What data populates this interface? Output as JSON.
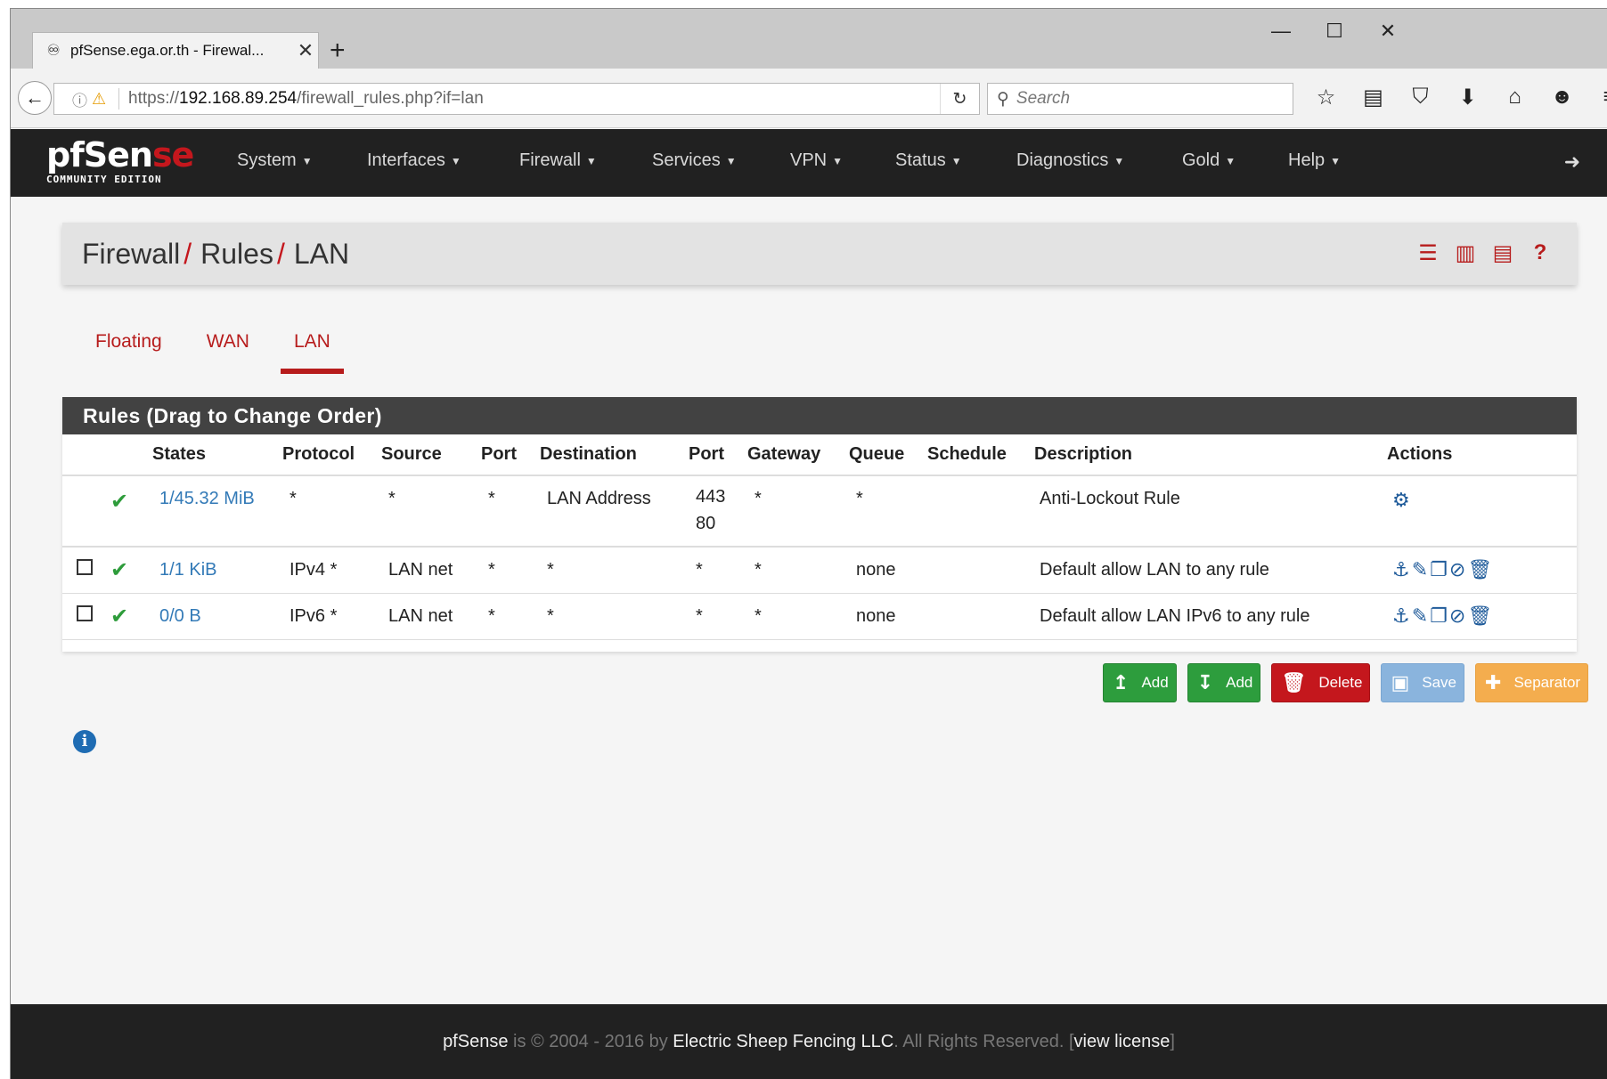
{
  "browser": {
    "tab_title": "pfSense.ega.or.th - Firewal...",
    "tab_close": "✕",
    "new_tab": "+",
    "url_scheme": "https://",
    "url_host": "192.168.89.254",
    "url_path": "/firewall_rules.php?if=lan",
    "search_placeholder": "Search",
    "window_controls": [
      "—",
      "☐",
      "✕"
    ]
  },
  "app": {
    "logo_main_a": "pfSen",
    "logo_main_b": "se",
    "logo_sub": "COMMUNITY EDITION",
    "menu": [
      "System",
      "Interfaces",
      "Firewall",
      "Services",
      "VPN",
      "Status",
      "Diagnostics",
      "Gold",
      "Help"
    ]
  },
  "page": {
    "breadcrumb": [
      "Firewall",
      "Rules",
      "LAN"
    ],
    "breadcrumb_sep": "/",
    "tabs": [
      "Floating",
      "WAN",
      "LAN"
    ],
    "active_tab": "LAN"
  },
  "rules": {
    "panel_title": "Rules (Drag to Change Order)",
    "columns": [
      "States",
      "Protocol",
      "Source",
      "Port",
      "Destination",
      "Port",
      "Gateway",
      "Queue",
      "Schedule",
      "Description",
      "Actions"
    ],
    "rows": [
      {
        "states": "1/45.32 MiB",
        "protocol": "*",
        "source": "*",
        "src_port": "*",
        "destination": "LAN Address",
        "dst_port_1": "443",
        "dst_port_2": "80",
        "gateway": "*",
        "queue": "*",
        "schedule": "",
        "description": "Anti-Lockout Rule"
      },
      {
        "states": "1/1 KiB",
        "protocol": "IPv4 *",
        "source": "LAN net",
        "src_port": "*",
        "destination": "*",
        "dst_port_1": "*",
        "dst_port_2": "",
        "gateway": "*",
        "queue": "none",
        "schedule": "",
        "description": "Default allow LAN to any rule"
      },
      {
        "states": "0/0 B",
        "protocol": "IPv6 *",
        "source": "LAN net",
        "src_port": "*",
        "destination": "*",
        "dst_port_1": "*",
        "dst_port_2": "",
        "gateway": "*",
        "queue": "none",
        "schedule": "",
        "description": "Default allow LAN IPv6 to any rule"
      }
    ]
  },
  "buttons": {
    "add_top": "Add",
    "add_bottom": "Add",
    "delete": "Delete",
    "save": "Save",
    "separator": "Separator"
  },
  "footer": {
    "brand": "pfSense",
    "text1": " is © 2004 - 2016 by ",
    "company": "Electric Sheep Fencing LLC",
    "text2": ". All Rights Reserved. [",
    "license": "view license",
    "text3": "]"
  }
}
